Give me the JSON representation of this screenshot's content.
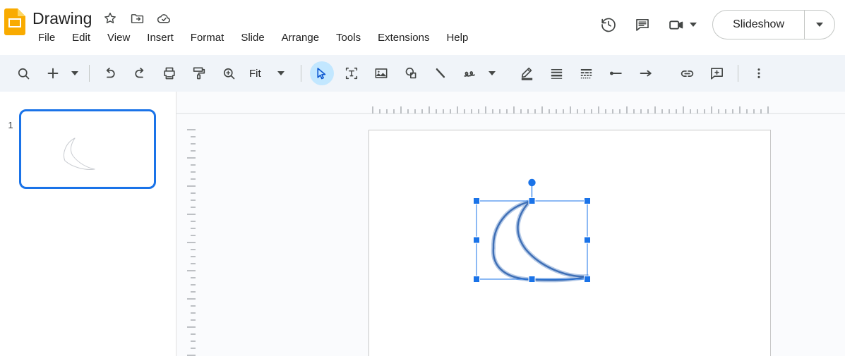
{
  "app": {
    "logo_icon": "slides-logo-icon",
    "title": "Drawing"
  },
  "header": {
    "title_icons": [
      {
        "name": "star-icon",
        "label": "Star"
      },
      {
        "name": "move-to-folder-icon",
        "label": "Move"
      },
      {
        "name": "cloud-saved-icon",
        "label": "Saved to Drive"
      }
    ],
    "menus": [
      "File",
      "Edit",
      "View",
      "Insert",
      "Format",
      "Slide",
      "Arrange",
      "Tools",
      "Extensions",
      "Help"
    ],
    "right_icons": [
      {
        "name": "version-history-icon",
        "label": "Version history"
      },
      {
        "name": "comment-icon",
        "label": "Open comment history"
      },
      {
        "name": "present-video-icon",
        "label": "Join a call"
      }
    ],
    "slideshow": {
      "label": "Slideshow",
      "dropdown_icon": "chevron-down-icon"
    }
  },
  "toolbar": {
    "items": [
      {
        "name": "search-icon",
        "label": "Search"
      },
      {
        "name": "new-slide-icon",
        "label": "New slide"
      },
      {
        "name": "new-slide-dropdown-icon",
        "label": "New slide options"
      },
      {
        "name": "undo-icon",
        "label": "Undo"
      },
      {
        "name": "redo-icon",
        "label": "Redo"
      },
      {
        "name": "print-icon",
        "label": "Print"
      },
      {
        "name": "paint-format-icon",
        "label": "Paint format"
      },
      {
        "name": "zoom-icon",
        "label": "Zoom"
      }
    ],
    "zoom_value": "Fit",
    "zoom_dropdown_icon": "chevron-down-icon",
    "tools": [
      {
        "name": "select-tool",
        "label": "Select",
        "active": true
      },
      {
        "name": "text-box-tool",
        "label": "Text box",
        "active": false
      },
      {
        "name": "insert-image-tool",
        "label": "Insert image",
        "active": false
      },
      {
        "name": "shape-tool",
        "label": "Shape",
        "active": false
      },
      {
        "name": "line-tool",
        "label": "Line",
        "active": false
      },
      {
        "name": "curve-tool",
        "label": "Curve",
        "active": false
      },
      {
        "name": "curve-dropdown-icon",
        "label": "Line options",
        "active": false
      }
    ],
    "highlighted_group": {
      "highlight_color": "#e53935",
      "items": [
        {
          "name": "line-color-icon",
          "label": "Line color"
        },
        {
          "name": "line-weight-icon",
          "label": "Line weight"
        },
        {
          "name": "line-dash-icon",
          "label": "Line dash"
        },
        {
          "name": "line-start-icon",
          "label": "Line start"
        },
        {
          "name": "line-end-icon",
          "label": "Line end"
        }
      ]
    },
    "end_items": [
      {
        "name": "insert-link-icon",
        "label": "Insert link"
      },
      {
        "name": "add-comment-icon",
        "label": "Add comment"
      },
      {
        "name": "more-options-icon",
        "label": "More"
      }
    ]
  },
  "sidebar": {
    "slides": [
      {
        "number": "1",
        "selected": true,
        "selection_color": "#1a73e8"
      }
    ]
  },
  "canvas": {
    "zoom_fit": "Fit",
    "ruler_horizontal": {
      "name": "horizontal-ruler",
      "visible": true
    },
    "ruler_vertical": {
      "name": "vertical-ruler",
      "visible": true
    },
    "selected_object": {
      "name": "curve-shape",
      "type": "scribble-curve",
      "stroke_color": "#4a7ebb",
      "selection_color": "#1a73e8",
      "handles": 8,
      "rotation_handle": true
    }
  },
  "colors": {
    "toolbar_bg": "#f0f4f9",
    "canvas_bg": "#fafbfd",
    "accent": "#0b57d0",
    "active_tool_bg": "#c2e7ff",
    "highlight": "#e53935",
    "logo": "#f9ab00"
  }
}
